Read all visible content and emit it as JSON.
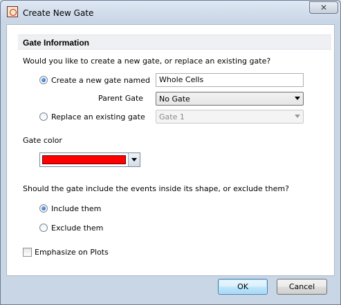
{
  "window": {
    "title": "Create New Gate",
    "icon": "app-icon",
    "close_label": "✕"
  },
  "section": {
    "header": "Gate Information"
  },
  "question1": "Would you like to create a new gate, or replace an existing gate?",
  "create_option": {
    "label": "Create a new gate named",
    "checked": true,
    "name_value": "Whole Cells"
  },
  "parent_gate": {
    "label": "Parent Gate",
    "selected": "No Gate"
  },
  "replace_option": {
    "label": "Replace an existing gate",
    "checked": false,
    "selected": "Gate 1"
  },
  "gate_color": {
    "label": "Gate color",
    "value": "#ff0000"
  },
  "question2": "Should the gate include the events inside its shape, or exclude them?",
  "include_option": {
    "label": "Include them",
    "checked": true
  },
  "exclude_option": {
    "label": "Exclude them",
    "checked": false
  },
  "emphasize": {
    "label": "Emphasize on Plots",
    "checked": false
  },
  "buttons": {
    "ok": "OK",
    "cancel": "Cancel"
  }
}
